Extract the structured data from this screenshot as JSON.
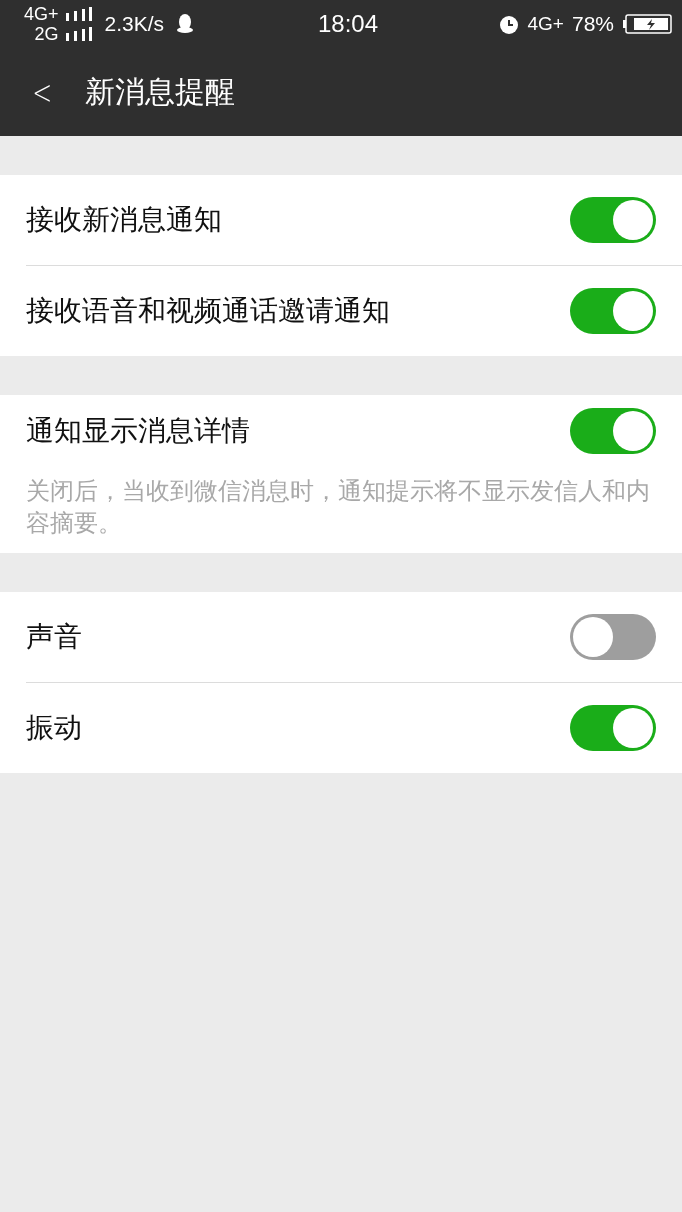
{
  "status_bar": {
    "network_1": "4G+",
    "network_2": "2G",
    "speed": "2.3K/s",
    "time": "18:04",
    "network_3": "4G+",
    "battery": "78%"
  },
  "header": {
    "back": "<",
    "title": "新消息提醒"
  },
  "groups": [
    {
      "rows": [
        {
          "label": "接收新消息通知",
          "on": true
        },
        {
          "label": "接收语音和视频通话邀请通知",
          "on": true
        }
      ]
    },
    {
      "rows": [
        {
          "label": "通知显示消息详情",
          "on": true
        }
      ],
      "note": "关闭后，当收到微信消息时，通知提示将不显示发信人和内容摘要。"
    },
    {
      "rows": [
        {
          "label": "声音",
          "on": false
        },
        {
          "label": "振动",
          "on": true
        }
      ]
    }
  ]
}
